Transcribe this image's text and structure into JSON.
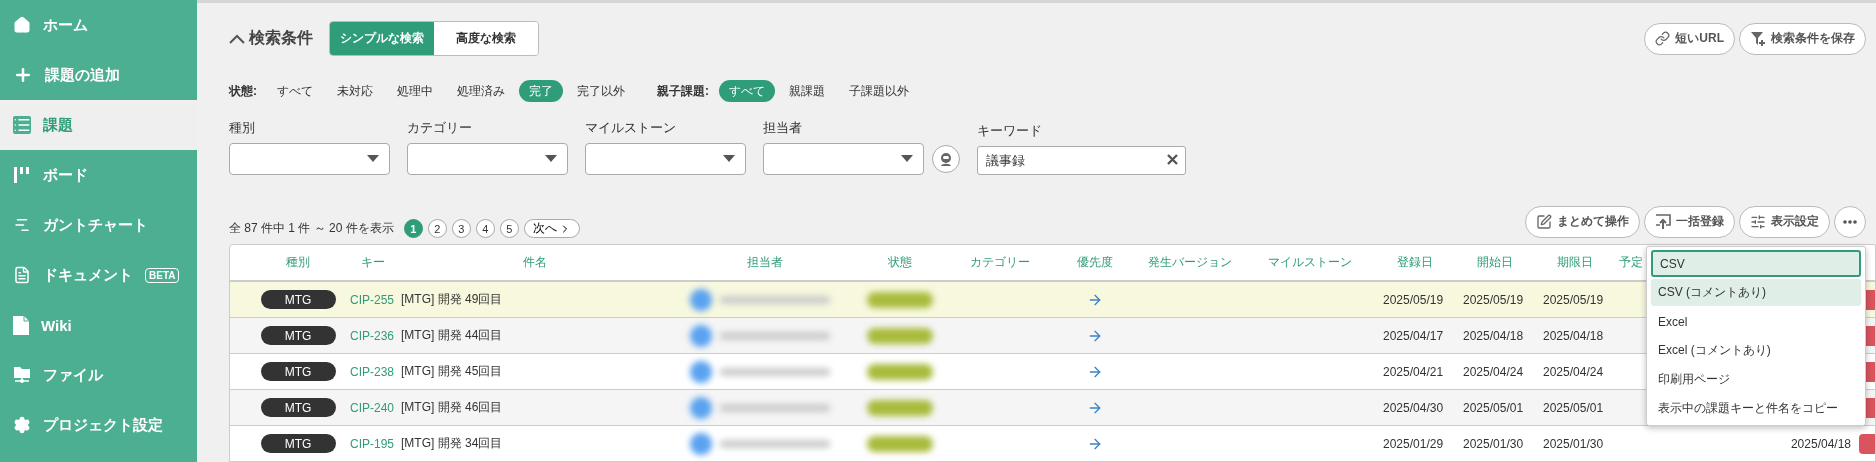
{
  "sidebar": {
    "items": [
      {
        "label": "ホーム",
        "selected": false
      },
      {
        "label": "課題の追加",
        "selected": false
      },
      {
        "label": "課題",
        "selected": true
      },
      {
        "label": "ボード",
        "selected": false
      },
      {
        "label": "ガントチャート",
        "selected": false
      },
      {
        "label": "ドキュメント",
        "selected": false,
        "badge": "BETA"
      },
      {
        "label": "Wiki",
        "selected": false
      },
      {
        "label": "ファイル",
        "selected": false
      },
      {
        "label": "プロジェクト設定",
        "selected": false
      }
    ]
  },
  "search": {
    "title": "検索条件",
    "expanded": true,
    "modes": [
      {
        "label": "シンプルな検索",
        "selected": true
      },
      {
        "label": "高度な検索",
        "selected": false
      }
    ],
    "actions": [
      "短いURL",
      "検索条件を保存"
    ],
    "filters": [
      {
        "label": "状態:",
        "options": [
          {
            "label": "すべて",
            "selected": false
          },
          {
            "label": "未対応",
            "selected": false
          },
          {
            "label": "処理中",
            "selected": false
          },
          {
            "label": "処理済み",
            "selected": false
          },
          {
            "label": "完了",
            "selected": true
          },
          {
            "label": "完了以外",
            "selected": false
          }
        ]
      },
      {
        "label": "親子課題:",
        "options": [
          {
            "label": "すべて",
            "selected": true
          },
          {
            "label": "親課題",
            "selected": false
          },
          {
            "label": "子課題以外",
            "selected": false
          }
        ]
      }
    ],
    "fields": [
      {
        "label": "種別",
        "kind": "select"
      },
      {
        "label": "カテゴリー",
        "kind": "select"
      },
      {
        "label": "マイルストーン",
        "kind": "select"
      },
      {
        "label": "担当者",
        "kind": "assignee"
      },
      {
        "label": "キーワード",
        "kind": "text",
        "value": "議事録"
      }
    ]
  },
  "pagination": {
    "summary": "全 87 件中 1 件 ～ 20 件を表示",
    "pages": [
      {
        "label": "1",
        "selected": true
      },
      {
        "label": "2",
        "selected": false
      },
      {
        "label": "3",
        "selected": false
      },
      {
        "label": "4",
        "selected": false
      },
      {
        "label": "5",
        "selected": false
      }
    ],
    "next": "次へ"
  },
  "toolbar": [
    "まとめて操作",
    "一括登録",
    "表示設定"
  ],
  "table": {
    "columns": [
      "種別",
      "キー",
      "件名",
      "担当者",
      "状態",
      "カテゴリー",
      "優先度",
      "発生バージョン",
      "マイルストーン",
      "登録日",
      "開始日",
      "期限日",
      "予定"
    ],
    "rows": [
      {
        "type": "MTG",
        "key": "CIP-255",
        "subject": "[MTG] 開発 49回目",
        "created": "2025/05/19",
        "start": "2025/05/19",
        "due": "2025/05/19",
        "highlighted": true
      },
      {
        "type": "MTG",
        "key": "CIP-236",
        "subject": "[MTG] 開発 44回目",
        "created": "2025/04/17",
        "start": "2025/04/18",
        "due": "2025/04/18",
        "highlighted": false
      },
      {
        "type": "MTG",
        "key": "CIP-238",
        "subject": "[MTG] 開発 45回目",
        "created": "2025/04/21",
        "start": "2025/04/24",
        "due": "2025/04/24",
        "highlighted": false
      },
      {
        "type": "MTG",
        "key": "CIP-240",
        "subject": "[MTG] 開発 46回目",
        "created": "2025/04/30",
        "start": "2025/05/01",
        "due": "2025/05/01",
        "highlighted": false
      },
      {
        "type": "MTG",
        "key": "CIP-195",
        "subject": "[MTG] 開発 34回目",
        "created": "2025/01/29",
        "start": "2025/01/30",
        "due": "2025/01/30",
        "highlighted": false,
        "column_14": "2025/04/18"
      }
    ]
  },
  "export_menu": {
    "items": [
      {
        "label": "CSV",
        "selected": true,
        "hovered": false
      },
      {
        "label": "CSV (コメントあり)",
        "selected": false,
        "hovered": true
      },
      {
        "label": "Excel",
        "selected": false,
        "hovered": false
      },
      {
        "label": "Excel (コメントあり)",
        "selected": false,
        "hovered": false
      },
      {
        "label": "印刷用ページ",
        "selected": false,
        "hovered": false
      },
      {
        "label": "表示中の課題キーと件名をコピー",
        "selected": false,
        "hovered": false
      }
    ]
  }
}
